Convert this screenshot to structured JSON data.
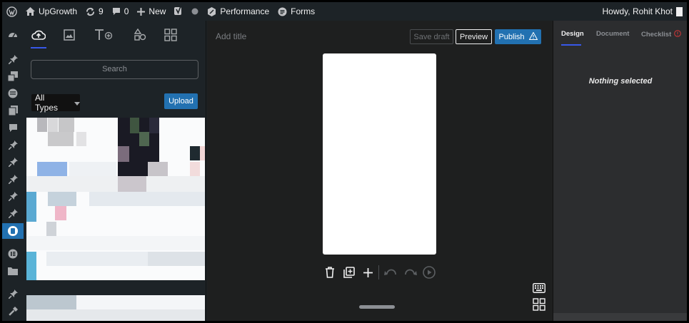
{
  "admin_bar": {
    "wp_logo_icon": "wordpress-logo",
    "site_name": "UpGrowth",
    "updates_count": "9",
    "comments_count": "0",
    "new_label": "New",
    "performance_label": "Performance",
    "forms_label": "Forms",
    "greeting": "Howdy, Rohit Khot"
  },
  "admin_menu": {
    "icons": [
      "dashboard-icon",
      "pin-icon",
      "media-icon",
      "layers-icon",
      "pages-icon",
      "comment-icon",
      "pin-icon",
      "pin-icon",
      "pin-icon",
      "pin-icon",
      "pin-icon",
      "stories-icon",
      "elementor-icon",
      "folder-icon",
      "pin-icon",
      "tools-icon"
    ],
    "active_color": "#2271b1"
  },
  "library": {
    "tabs": [
      "upload-cloud-icon",
      "image-icon",
      "text-icon",
      "shapes-icon",
      "templates-icon"
    ],
    "search_placeholder": "Search",
    "type_filter": "All Types",
    "upload_label": "Upload"
  },
  "editor": {
    "title_placeholder": "Add title",
    "save_draft_label": "Save draft",
    "preview_label": "Preview",
    "publish_label": "Publish",
    "canvas_color": "#ffffff"
  },
  "inspector": {
    "tabs": [
      "Design",
      "Document",
      "Checklist"
    ],
    "empty_message": "Nothing selected"
  }
}
